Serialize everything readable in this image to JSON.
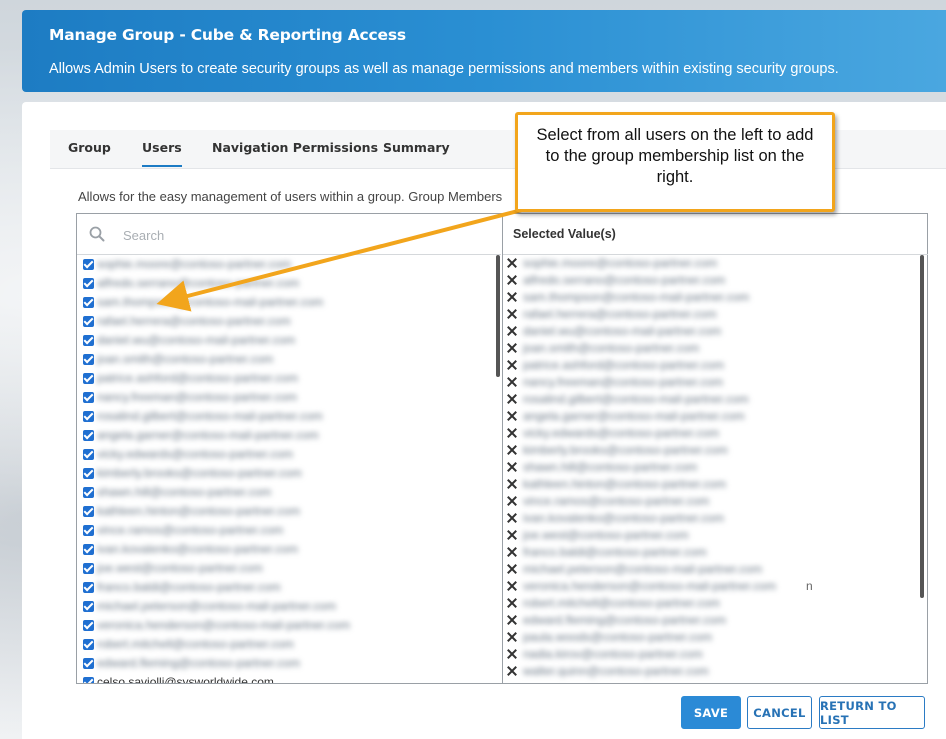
{
  "header": {
    "title": "Manage Group - Cube & Reporting Access",
    "subtitle": "Allows Admin Users to create security groups as well as manage permissions and members within existing security groups."
  },
  "tabs": [
    {
      "label": "Group",
      "active": false
    },
    {
      "label": "Users",
      "active": true
    },
    {
      "label": "Navigation Permissions",
      "active": false
    },
    {
      "label": "Summary",
      "active": false
    }
  ],
  "description": "Allows for the easy management of users within a group. Group Members",
  "search": {
    "placeholder": "Search",
    "value": ""
  },
  "selected_header": "Selected Value(s)",
  "users": [
    {
      "email": "sophie.moore@contoso-partner.com",
      "checked": true
    },
    {
      "email": "alfredo.serrano@contoso-partner.com",
      "checked": true
    },
    {
      "email": "sam.thompson@contoso-mail-partner.com",
      "checked": true
    },
    {
      "email": "rafael.herrera@contoso-partner.com",
      "checked": true
    },
    {
      "email": "daniel.wu@contoso-mail-partner.com",
      "checked": true
    },
    {
      "email": "joan.smith@contoso-partner.com",
      "checked": true
    },
    {
      "email": "patrice.ashford@contoso-partner.com",
      "checked": true
    },
    {
      "email": "nancy.freeman@contoso-partner.com",
      "checked": true
    },
    {
      "email": "rosalind.gilbert@contoso-mail-partner.com",
      "checked": true
    },
    {
      "email": "angela.garner@contoso-mail-partner.com",
      "checked": true
    },
    {
      "email": "vicky.edwards@contoso-partner.com",
      "checked": true
    },
    {
      "email": "kimberly.brooks@contoso-partner.com",
      "checked": true
    },
    {
      "email": "shawn.hill@contoso-partner.com",
      "checked": true
    },
    {
      "email": "kathleen.hinton@contoso-partner.com",
      "checked": true
    },
    {
      "email": "vince.ramos@contoso-partner.com",
      "checked": true
    },
    {
      "email": "ivan.kovalenko@contoso-partner.com",
      "checked": true
    },
    {
      "email": "joe.west@contoso-partner.com",
      "checked": true
    },
    {
      "email": "franco.baldi@contoso-partner.com",
      "checked": true
    },
    {
      "email": "michael.peterson@contoso-mail-partner.com",
      "checked": true
    },
    {
      "email": "veronica.henderson@contoso-mail-partner.com",
      "checked": true
    },
    {
      "email": "robert.mitchell@contoso-partner.com",
      "checked": true
    },
    {
      "email": "edward.fleming@contoso-partner.com",
      "checked": true
    },
    {
      "email": "celso.saviolli@sysworldwide.com",
      "checked": true,
      "visible_text": true
    }
  ],
  "selected": [
    {
      "email": "sophie.moore@contoso-partner.com"
    },
    {
      "email": "alfredo.serrano@contoso-partner.com"
    },
    {
      "email": "sam.thompson@contoso-mail-partner.com"
    },
    {
      "email": "rafael.herrera@contoso-partner.com"
    },
    {
      "email": "daniel.wu@contoso-mail-partner.com"
    },
    {
      "email": "joan.smith@contoso-partner.com"
    },
    {
      "email": "patrice.ashford@contoso-partner.com"
    },
    {
      "email": "nancy.freeman@contoso-partner.com"
    },
    {
      "email": "rosalind.gilbert@contoso-mail-partner.com"
    },
    {
      "email": "angela.garner@contoso-mail-partner.com"
    },
    {
      "email": "vicky.edwards@contoso-partner.com"
    },
    {
      "email": "kimberly.brooks@contoso-partner.com"
    },
    {
      "email": "shawn.hill@contoso-partner.com"
    },
    {
      "email": "kathleen.hinton@contoso-partner.com"
    },
    {
      "email": "vince.ramos@contoso-partner.com"
    },
    {
      "email": "ivan.kovalenko@contoso-partner.com"
    },
    {
      "email": "joe.west@contoso-partner.com"
    },
    {
      "email": "franco.baldi@contoso-partner.com"
    },
    {
      "email": "michael.peterson@contoso-mail-partner.com"
    },
    {
      "email": "veronica.henderson@contoso-mail-partner.com",
      "suffix": "n"
    },
    {
      "email": "robert.mitchell@contoso-partner.com"
    },
    {
      "email": "edward.fleming@contoso-partner.com"
    },
    {
      "email": "paula.woods@contoso-partner.com"
    },
    {
      "email": "nadia.kirov@contoso-partner.com"
    },
    {
      "email": "walter.quinn@contoso-partner.com"
    }
  ],
  "buttons": {
    "save": "SAVE",
    "cancel": "CANCEL",
    "return": "RETURN TO LIST"
  },
  "callout": {
    "text": "Select from all users on the left to add to the group membership list on the right."
  },
  "colors": {
    "accent": "#2b8ad6",
    "header": "#1d7cc3",
    "callout_border": "#f2a51c",
    "checkbox": "#1f6fd1"
  }
}
